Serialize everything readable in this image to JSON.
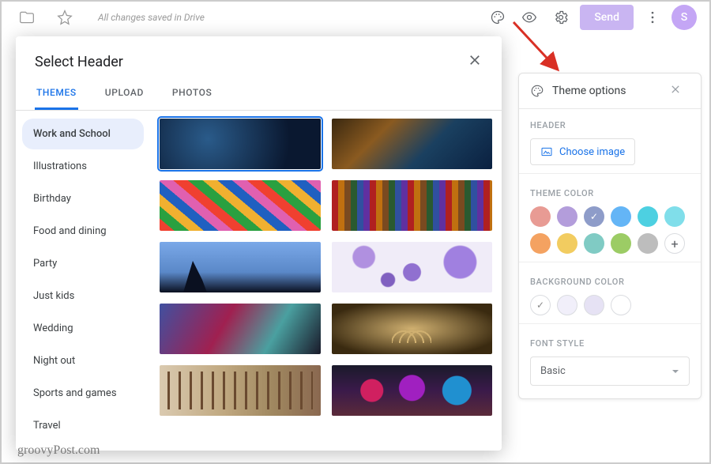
{
  "topbar": {
    "saved_text": "All changes saved in Drive",
    "send_label": "Send",
    "avatar_letter": "S"
  },
  "modal": {
    "title": "Select Header",
    "tabs": [
      "THEMES",
      "UPLOAD",
      "PHOTOS"
    ],
    "active_tab_index": 0,
    "categories": [
      "Work and School",
      "Illustrations",
      "Birthday",
      "Food and dining",
      "Party",
      "Just kids",
      "Wedding",
      "Night out",
      "Sports and games",
      "Travel"
    ],
    "active_category_index": 0
  },
  "theme_panel": {
    "title": "Theme options",
    "header_label": "HEADER",
    "choose_image_label": "Choose image",
    "theme_color_label": "THEME COLOR",
    "colors": [
      "#e89b94",
      "#b39ddb",
      "#8e9cc9",
      "#64b5f6",
      "#4dd0e1",
      "#80deea",
      "#f4a261",
      "#f2cc60",
      "#80cbc4",
      "#9ccc65",
      "#bdbdbd"
    ],
    "selected_color_index": 2,
    "background_label": "BACKGROUND COLOR",
    "bg_colors": [
      "#ffffff",
      "#f1effa",
      "#e6e2f4",
      "#ffffff"
    ],
    "selected_bg_index": 0,
    "font_label": "FONT STYLE",
    "font_value": "Basic"
  },
  "watermark": "groovyPost.com"
}
